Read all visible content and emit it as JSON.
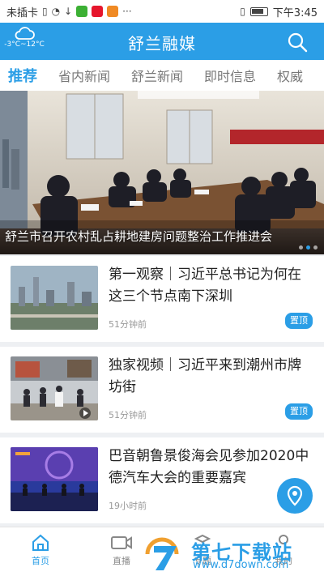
{
  "status_bar": {
    "carrier": "未插卡",
    "time": "下午3:45",
    "more": "···"
  },
  "header": {
    "title": "舒兰融媒",
    "temperature": "-3°C~12°C",
    "accent_color": "#2b9ee6"
  },
  "tabs": [
    {
      "label": "推荐"
    },
    {
      "label": "省内新闻"
    },
    {
      "label": "舒兰新闻"
    },
    {
      "label": "即时信息"
    },
    {
      "label": "权威"
    }
  ],
  "hero": {
    "caption": "舒兰市召开农村乱占耕地建房问题整治工作推进会"
  },
  "feed": [
    {
      "headline": "第一观察｜习近平总书记为何在这三个节点南下深圳",
      "time": "51分钟前",
      "badge": "置顶"
    },
    {
      "headline": "独家视频｜习近平来到潮州市牌坊街",
      "time": "51分钟前",
      "badge": "置顶"
    },
    {
      "headline": "巴音朝鲁景俊海会见参加2020中德汽车大会的重要嘉宾",
      "time": "19小时前",
      "badge": ""
    }
  ],
  "bottom_nav": [
    {
      "label": "首页"
    },
    {
      "label": "直播"
    },
    {
      "label": "专题"
    },
    {
      "label": "我的"
    }
  ],
  "watermark": {
    "title": "第七下载站",
    "url": "www.d7down.com"
  }
}
